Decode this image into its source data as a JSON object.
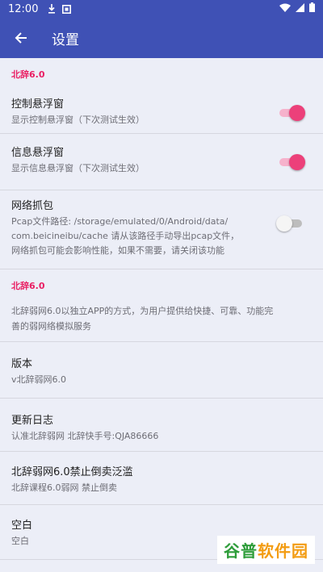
{
  "status_bar": {
    "time": "12:00",
    "icons": [
      "download-icon",
      "notification-icon",
      "wifi-icon",
      "cellular-icon",
      "battery-icon"
    ]
  },
  "app_bar": {
    "back_icon": "back-arrow-icon",
    "title": "设置"
  },
  "settings": {
    "section_title": "北辞6.0",
    "floating_control": {
      "title": "控制悬浮窗",
      "summary": "显示控制悬浮窗（下次测试生效）",
      "enabled": true
    },
    "floating_info": {
      "title": "信息悬浮窗",
      "summary": "显示信息悬浮窗（下次测试生效）",
      "enabled": true
    },
    "packet_capture": {
      "title": "网络抓包",
      "summary_lines": [
        "Pcap文件路径: /storage/emulated/0/Android/data/",
        "com.beicineibu/cache 请从该路径手动导出pcap文件，",
        "网络抓包可能会影响性能，如果不需要，请关闭该功能"
      ],
      "enabled": false
    }
  },
  "about": {
    "section_title": "北辞6.0",
    "description_lines": [
      "北辞弱网6.0以独立APP的方式，为用户提供给快捷、可靠、功能完",
      "善的弱网络模拟服务"
    ],
    "version": {
      "title": "版本",
      "summary": "v北辞弱网6.0"
    },
    "changelog": {
      "title": "更新日志",
      "summary": "认准北辞弱网 北辞快手号:QJA86666"
    },
    "notice": {
      "title": "北辞弱网6.0禁止倒卖泛滥",
      "summary": "北辞课程6.0弱网 禁止倒卖"
    },
    "blank": {
      "title": "空白",
      "summary": "空白"
    }
  },
  "watermark": {
    "part1": "谷普",
    "part2": "软件园"
  },
  "colors": {
    "primary": "#3f51b5",
    "accent": "#e91e63",
    "background": "#eceef7"
  }
}
